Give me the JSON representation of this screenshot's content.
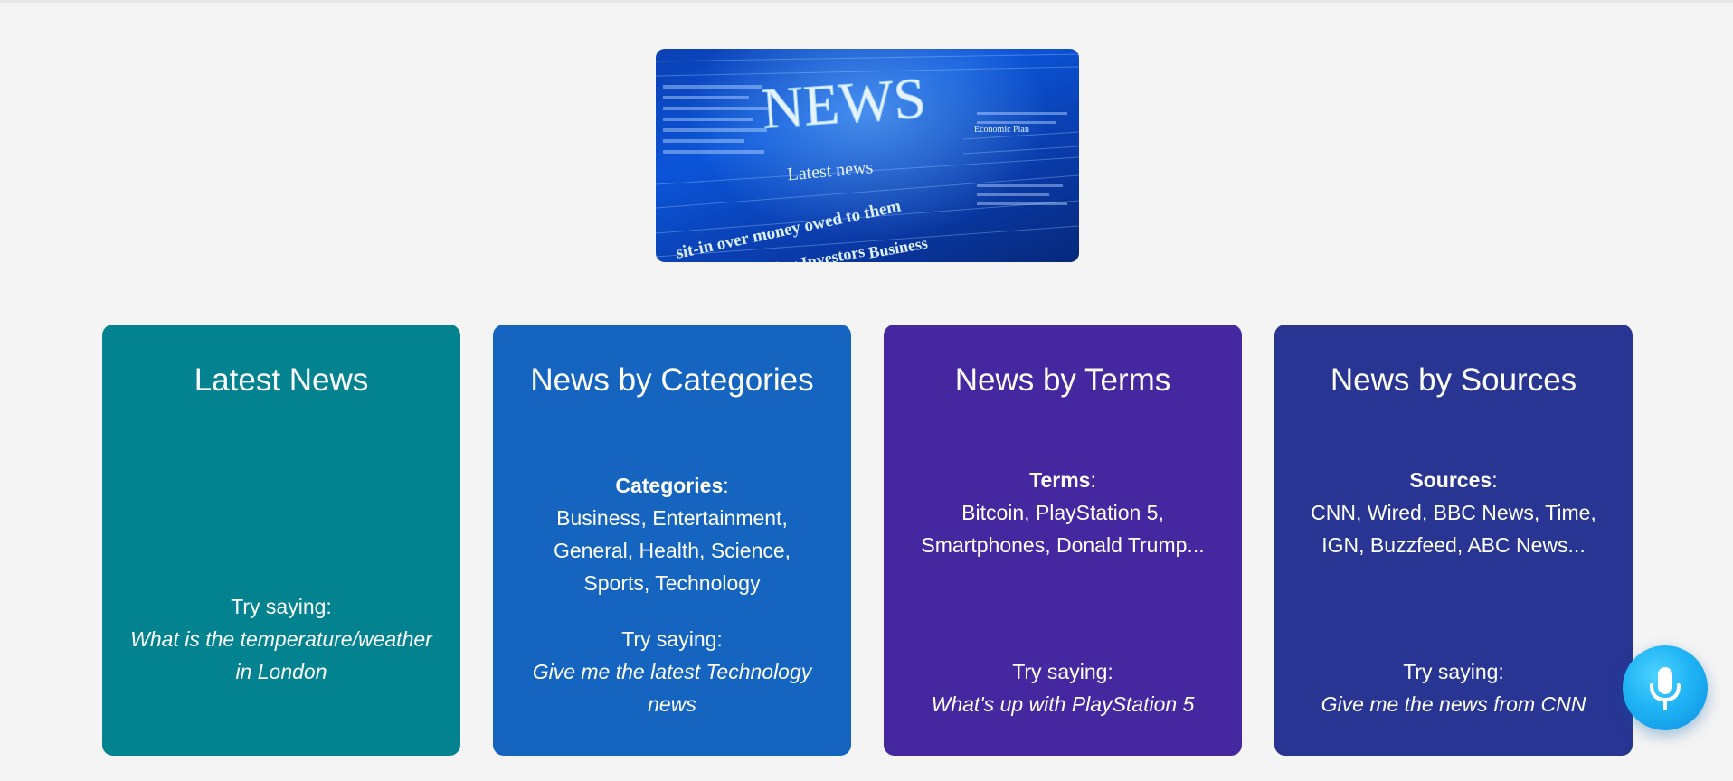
{
  "logo": {
    "headline": "NEWS",
    "subline": "Latest news",
    "text_lines": [
      "sit-in over money owed to them",
      "Attracting Investors",
      "Business",
      "Economic Plan"
    ]
  },
  "cards": [
    {
      "title": "Latest News",
      "color": "#02838f",
      "try_label": "Try saying:",
      "example": "What is the temperature/weather in London"
    },
    {
      "title": "News by Categories",
      "color": "#1565c0",
      "info_label": "Categories",
      "info_text": "Business, Entertainment, General, Health, Science, Sports, Technology",
      "try_label": "Try saying:",
      "example": "Give me the latest Technology news"
    },
    {
      "title": "News by Terms",
      "color": "#4527a0",
      "info_label": "Terms",
      "info_text": "Bitcoin, PlayStation 5, Smartphones, Donald Trump...",
      "try_label": "Try saying:",
      "example": "What's up with PlayStation 5"
    },
    {
      "title": "News by Sources",
      "color": "#283593",
      "info_label": "Sources",
      "info_text": "CNN, Wired, BBC News, Time, IGN, Buzzfeed, ABC News...",
      "try_label": "Try saying:",
      "example": "Give me the news from CNN"
    }
  ],
  "mic": {
    "icon": "microphone-icon",
    "color": "#1fb4f5"
  }
}
